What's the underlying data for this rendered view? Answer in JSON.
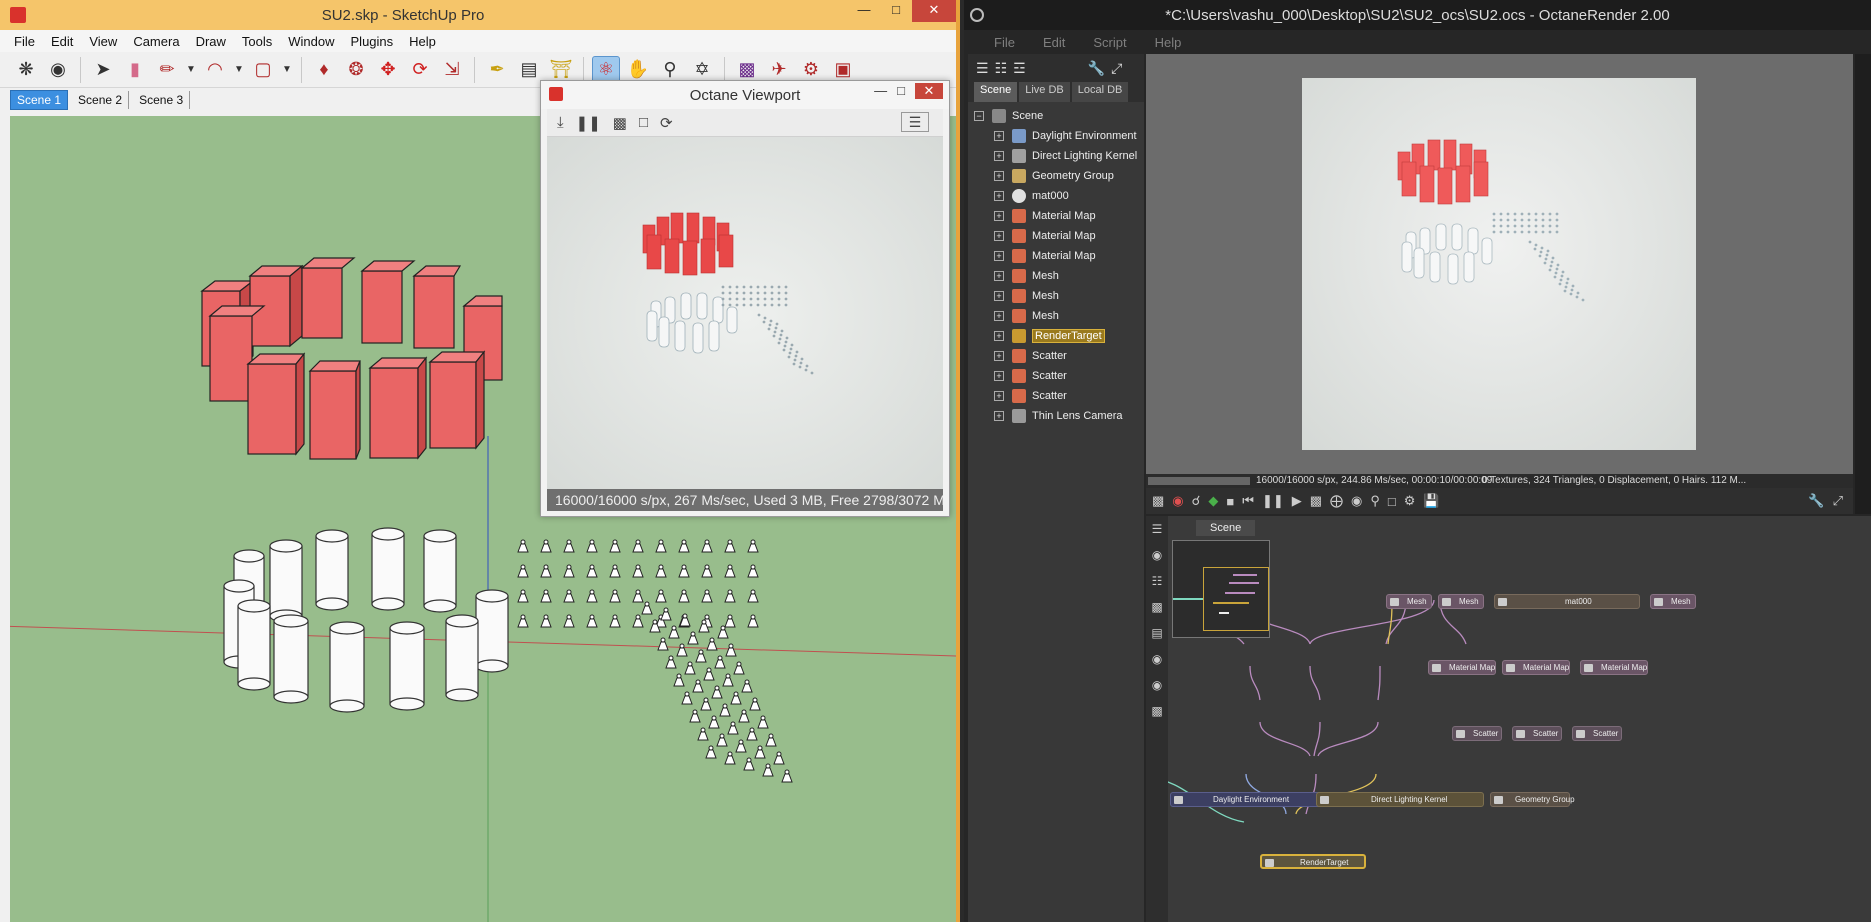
{
  "sketchup": {
    "title": "SU2.skp - SketchUp Pro",
    "menu": [
      "File",
      "Edit",
      "View",
      "Camera",
      "Draw",
      "Tools",
      "Window",
      "Plugins",
      "Help"
    ],
    "scenes": [
      "Scene 1",
      "Scene 2",
      "Scene 3"
    ],
    "active_scene": "Scene 1"
  },
  "octane_viewport": {
    "title": "Octane Viewport",
    "status": "16000/16000 s/px, 267 Ms/sec, Used 3 MB, Free 2798/3072 M"
  },
  "octane": {
    "title": "*C:\\Users\\vashu_000\\Desktop\\SU2\\SU2_ocs\\SU2.ocs - OctaneRender 2.00",
    "menu": [
      "File",
      "Edit",
      "Script",
      "Help"
    ],
    "outliner_tabs": [
      "Scene",
      "Live DB",
      "Local DB"
    ],
    "tree_root": "Scene",
    "tree_items": [
      {
        "label": "Daylight Environment",
        "icon": "environment-icon"
      },
      {
        "label": "Direct Lighting Kernel",
        "icon": "kernel-icon"
      },
      {
        "label": "Geometry Group",
        "icon": "geometry-icon"
      },
      {
        "label": "mat000",
        "icon": "material-sphere-icon"
      },
      {
        "label": "Material Map",
        "icon": "material-map-icon"
      },
      {
        "label": "Material Map",
        "icon": "material-map-icon"
      },
      {
        "label": "Material Map",
        "icon": "material-map-icon"
      },
      {
        "label": "Mesh",
        "icon": "mesh-icon"
      },
      {
        "label": "Mesh",
        "icon": "mesh-icon"
      },
      {
        "label": "Mesh",
        "icon": "mesh-icon"
      },
      {
        "label": "RenderTarget",
        "icon": "render-target-icon"
      },
      {
        "label": "Scatter",
        "icon": "scatter-icon"
      },
      {
        "label": "Scatter",
        "icon": "scatter-icon"
      },
      {
        "label": "Scatter",
        "icon": "scatter-icon"
      },
      {
        "label": "Thin Lens Camera",
        "icon": "camera-icon"
      }
    ],
    "selected_item": "RenderTarget",
    "render_progress": "16000/16000 s/px, 244.86 Ms/sec, 00:00:10/00:00:09",
    "render_stats": "0 Textures, 324 Triangles, 0 Displacement, 0 Hairs. 112 M...",
    "graph_tab": "Scene",
    "nodes": {
      "mesh1": "Mesh",
      "mesh2": "Mesh",
      "mat": "mat000",
      "mesh3": "Mesh",
      "mmap1": "Material Map",
      "mmap2": "Material Map",
      "mmap3": "Material Map",
      "scat1": "Scatter",
      "scat2": "Scatter",
      "scat3": "Scatter",
      "env": "Daylight Environment",
      "kern": "Direct Lighting Kernel",
      "geo": "Geometry Group",
      "rt": "RenderTarget"
    }
  },
  "colors": {
    "sketchup_titlebar": "#f5c56a",
    "ground": "#98bd8c",
    "box_red": "#e96565",
    "octane_bg": "#262626",
    "selection_gold": "#d9b23c"
  }
}
